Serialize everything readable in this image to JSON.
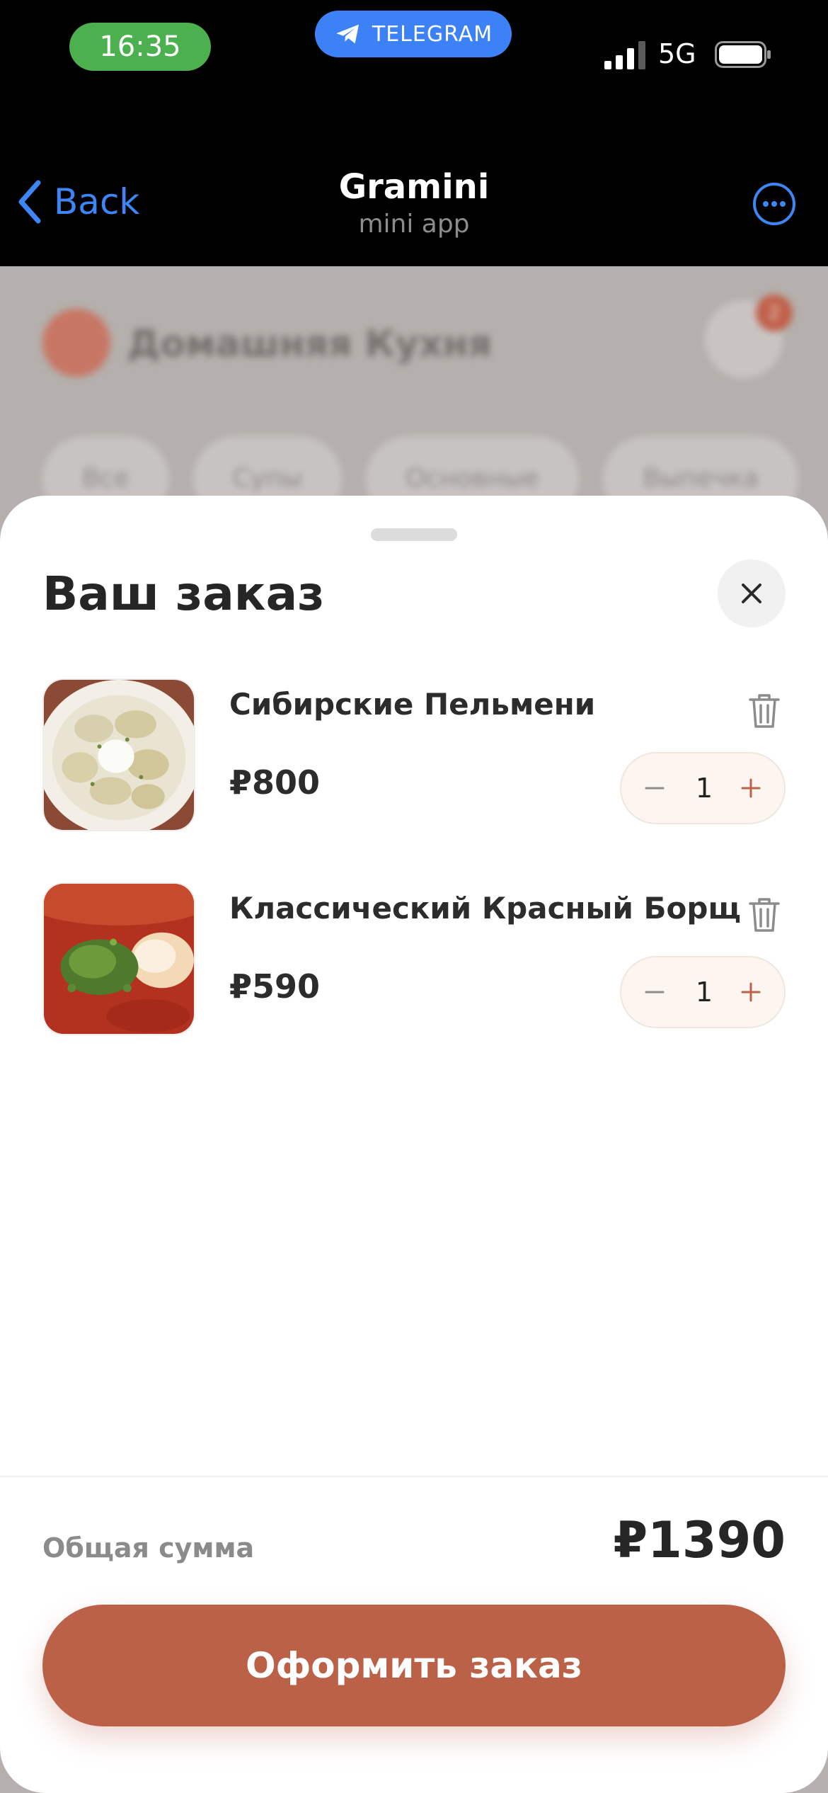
{
  "status_bar": {
    "time": "16:35",
    "telegram_label": "TELEGRAM",
    "network": "5G",
    "colors": {
      "time_pill": "#4cb04f",
      "telegram_pill": "#3c82f6"
    }
  },
  "header": {
    "back_label": "Back",
    "title": "Gramini",
    "subtitle": "mini app",
    "more_icon": "more-horizontal-icon"
  },
  "background_app": {
    "restaurant_name": "Домашняя Кухня",
    "cart_count": "2",
    "categories": [
      "Все",
      "Супы",
      "Основные",
      "Выпечка"
    ]
  },
  "order_sheet": {
    "title": "Ваш заказ",
    "close_icon": "close-icon",
    "items": [
      {
        "name": "Сибирские Пельмени",
        "price": "₽800",
        "quantity": "1",
        "image": "pelmeni-photo"
      },
      {
        "name": "Классический Красный Борщ",
        "price": "₽590",
        "quantity": "1",
        "image": "borsch-photo"
      }
    ],
    "total_label": "Общая сумма",
    "total_value": "₽1390",
    "checkout_label": "Оформить заказ",
    "accent_color": "#bb6147"
  }
}
